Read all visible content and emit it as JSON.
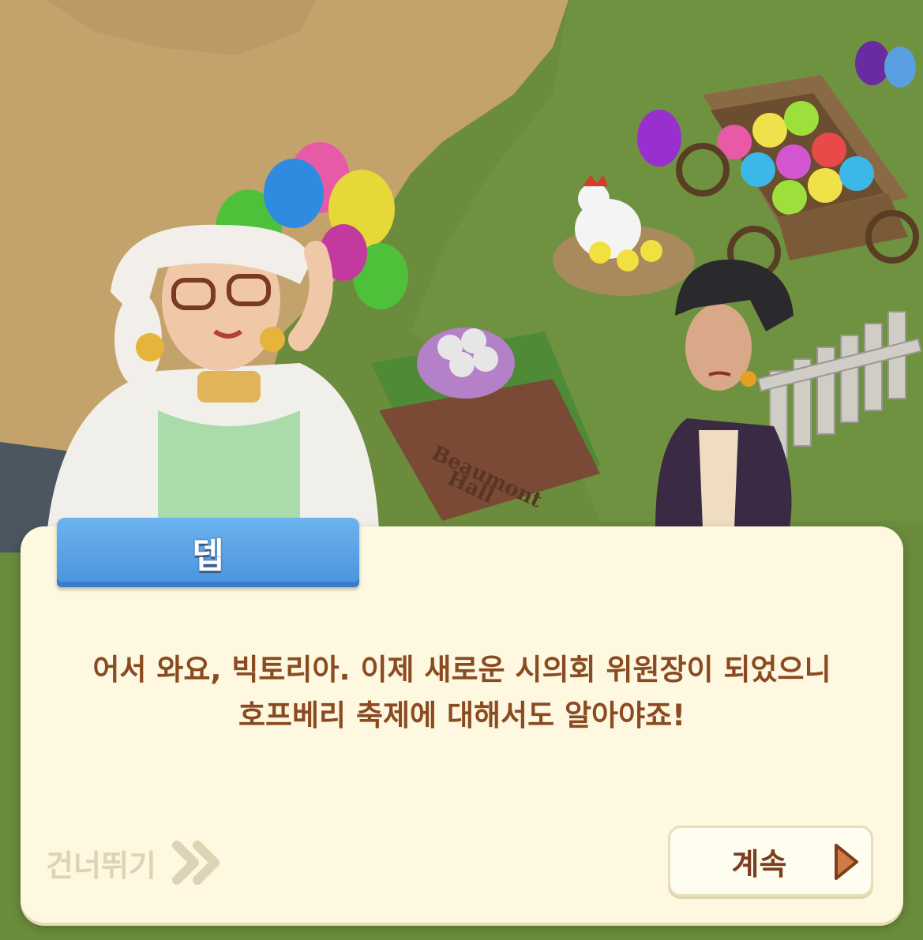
{
  "dialog": {
    "speaker_name": "뎁",
    "lines": [
      "어서 와요, 빅토리아. 이제 새로운 시의회 위원장이 되었으니",
      "호프베리 축제에 대해서도 알아야죠!"
    ]
  },
  "controls": {
    "skip_label": "건너뛰기",
    "continue_label": "계속"
  },
  "scene": {
    "sign_text": "Beaumont Hall",
    "icons": [
      "double-chevron-right-icon",
      "play-arrow-icon"
    ]
  },
  "colors": {
    "panel_bg": "#fdf8df",
    "name_tab": "#4a92dc",
    "dialog_text": "#8a4a22",
    "skip_text": "#dfd3b6",
    "continue_text": "#7a3e1e",
    "arrow_fill": "#d07a45"
  }
}
